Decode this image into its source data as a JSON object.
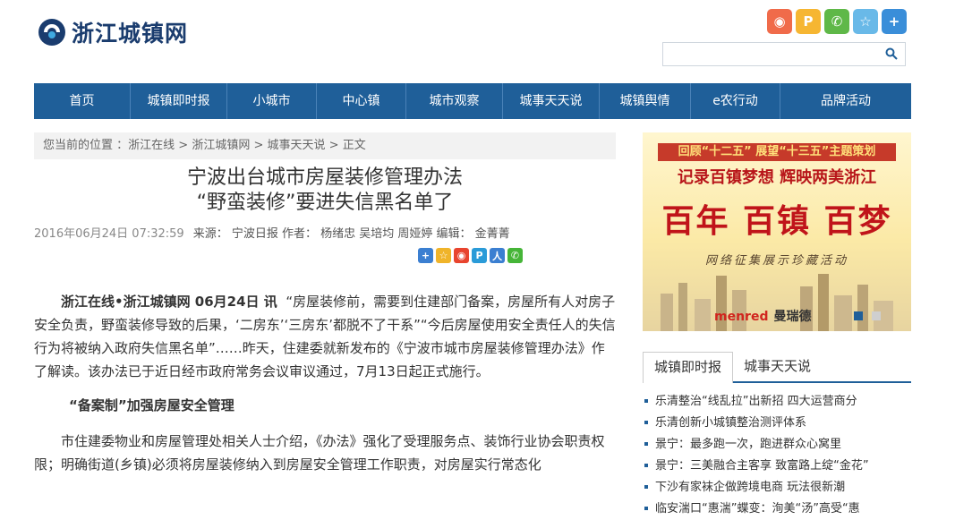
{
  "site": {
    "logo_text": "浙江城镇网"
  },
  "share_top": [
    {
      "icon": "weibo-icon",
      "color": "#f06b4a",
      "glyph": "◉"
    },
    {
      "icon": "p-icon",
      "color": "#f6b632",
      "glyph": "P"
    },
    {
      "icon": "wechat-icon",
      "color": "#5fb848",
      "glyph": "✆"
    },
    {
      "icon": "star-icon",
      "color": "#69b9e8",
      "glyph": "☆"
    },
    {
      "icon": "plus-icon",
      "color": "#3a8ed9",
      "glyph": "+"
    }
  ],
  "search": {
    "placeholder": ""
  },
  "nav": [
    "首页",
    "城镇即时报",
    "小城市",
    "中心镇",
    "城市观察",
    "城事天天说",
    "城镇舆情",
    "e农行动",
    "品牌活动"
  ],
  "breadcrumb": {
    "prefix": "您当前的位置 ：",
    "items": [
      "浙江在线",
      "浙江城镇网",
      "城事天天说",
      "正文"
    ],
    "sep": " > "
  },
  "article": {
    "title_line1": "宁波出台城市房屋装修管理办法",
    "title_line2": "“野蛮装修”要进失信黑名单了",
    "date": "2016年06月24日 07:32:59",
    "source": "来源：  宁波日报 作者： 杨绪忠 吴培均 周娅婷 编辑： 金菁菁",
    "share": [
      {
        "icon": "plus-share-icon",
        "color": "#3b7fd1",
        "glyph": "+"
      },
      {
        "icon": "star-share-icon",
        "color": "#f0b42a",
        "glyph": "☆"
      },
      {
        "icon": "weibo-share-icon",
        "color": "#e8442e",
        "glyph": "◉"
      },
      {
        "icon": "p-share-icon",
        "color": "#2a9bd8",
        "glyph": "P"
      },
      {
        "icon": "person-share-icon",
        "color": "#3b7fd1",
        "glyph": "人"
      },
      {
        "icon": "wechat-share-icon",
        "color": "#46b538",
        "glyph": "✆"
      }
    ],
    "lead": "浙江在线•浙江城镇网 06月24日 讯",
    "para1": "“房屋装修前，需要到住建部门备案，房屋所有人对房子安全负责，野蛮装修导致的后果，‘二房东’‘三房东’都脱不了干系”“今后房屋使用安全责任人的失信行为将被纳入政府失信黑名单”……昨天，住建委就新发布的《宁波市城市房屋装修管理办法》作了解读。该办法已于近日经市政府常务会议审议通过，7月13日起正式施行。",
    "subhead": "“备案制”加强房屋安全管理",
    "para2": "市住建委物业和房屋管理处相关人士介绍，《办法》强化了受理服务点、装饰行业协会职责权限；明确街道(乡镇)必须将房屋装修纳入到房屋安全管理工作职责，对房屋实行常态化"
  },
  "banner": {
    "top": "回顾“十二五” 展望“十三五”主题策划",
    "sub": "记录百镇梦想  辉映两美浙江",
    "big": "百年 百镇 百梦",
    "caption": "网络征集展示珍藏活动",
    "brand_en": "menred",
    "brand_cn": "曼瑞德"
  },
  "tabs": [
    "城镇即时报",
    "城事天天说"
  ],
  "news": [
    "乐清整治“线乱拉”出新招 四大运营商分",
    "乐清创新小城镇整治测评体系",
    "景宁：最多跑一次，跑进群众心窝里",
    "景宁：三美融合主客享 致富路上绽“金花”",
    "下沙有家袜企做跨境电商 玩法很新潮",
    "临安湍口“惠湍”蝶变：洵美“汤”高受“惠"
  ]
}
